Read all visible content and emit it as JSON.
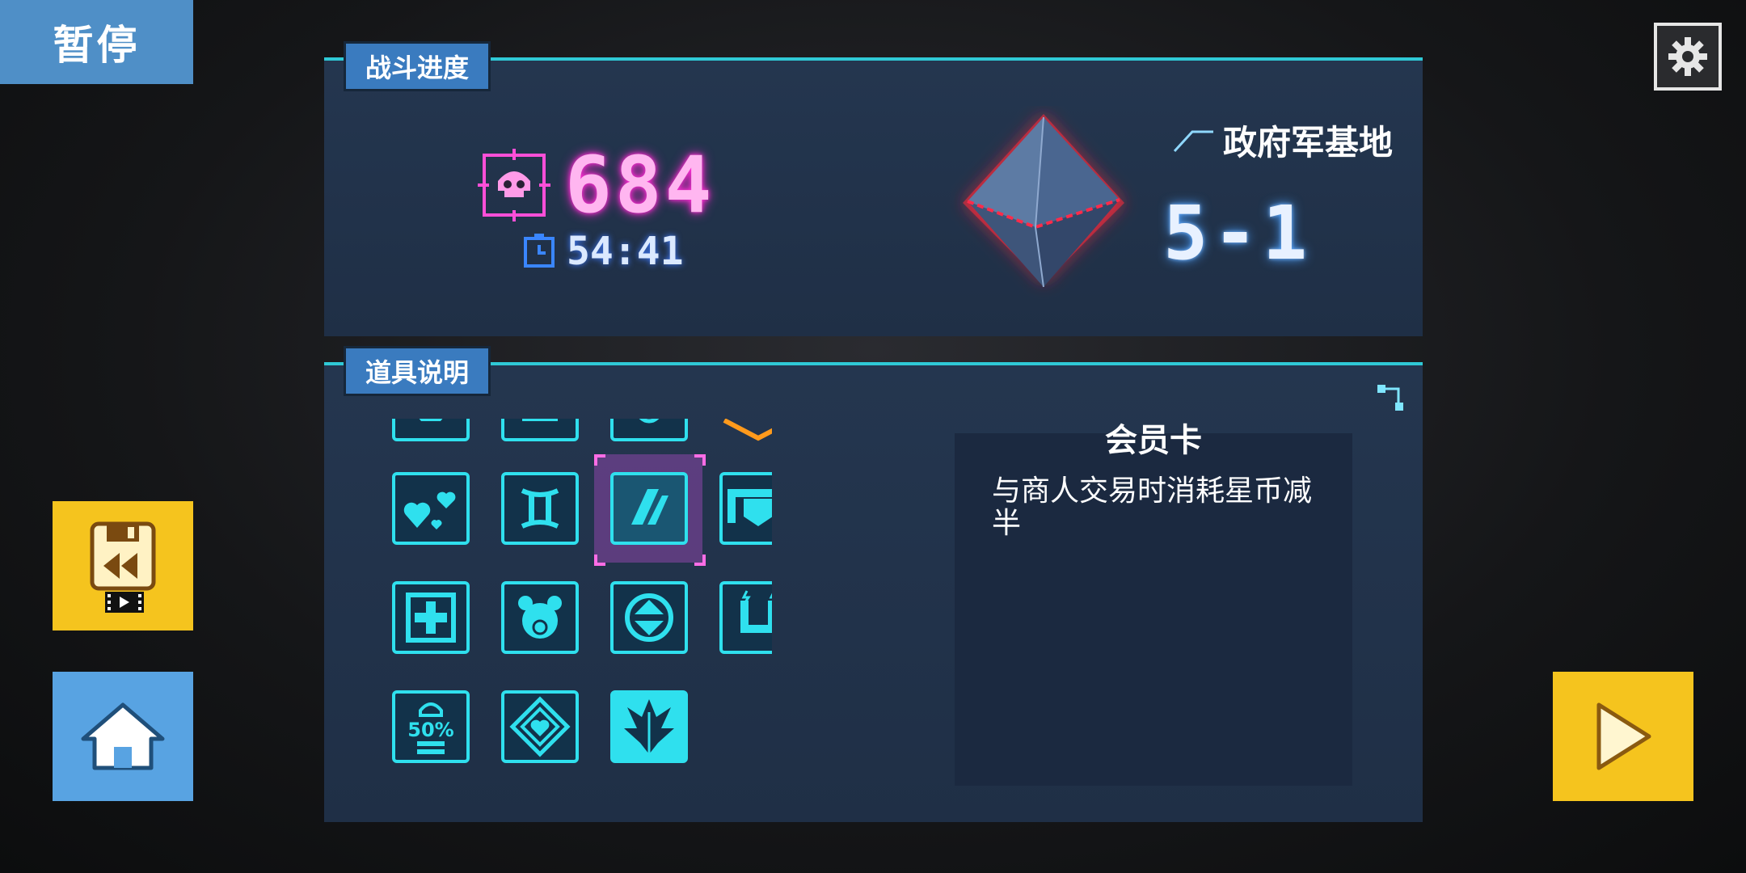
{
  "header": {
    "pause_title": "暂停"
  },
  "battle": {
    "tab_label": "战斗进度",
    "kill_count": "684",
    "time": "54:41",
    "location": "政府军基地",
    "stage": "5-1"
  },
  "items": {
    "tab_label": "道具说明",
    "selected": {
      "name": "会员卡",
      "description": "与商人交易时消耗星币减半"
    },
    "grid_icons": [
      "item-partial-1-icon",
      "item-partial-2-icon",
      "item-partial-3-icon",
      "item-partial-4-icon",
      "item-partial-5-icon",
      "hearts-icon",
      "gemini-icon",
      "member-card-icon",
      "belt-icon",
      "k-weapon-icon",
      "medkit-icon",
      "panda-icon",
      "target-arrows-icon",
      "magnet-icon",
      "toolbox-icon",
      "battery-50-icon",
      "diamond-heart-icon",
      "leaf-icon"
    ],
    "battery_label": "50%"
  },
  "colors": {
    "accent_cyan": "#2fe0ee",
    "kill_pink": "#ffb6f0",
    "tab_blue": "#3a7bbf",
    "button_yellow": "#f5c41e",
    "button_blue": "#58a3e2"
  }
}
